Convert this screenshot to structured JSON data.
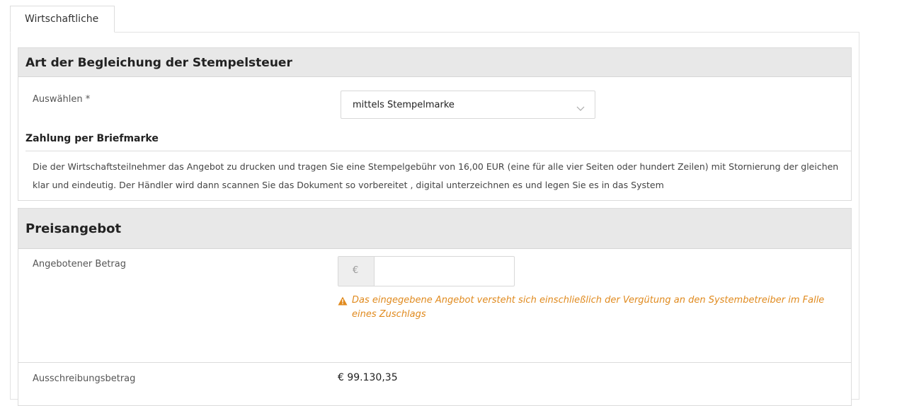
{
  "tab": {
    "label": "Wirtschaftliche"
  },
  "stamp_section": {
    "title": "Art der Begleichung der Stempelsteuer",
    "select_label": "Auswählen *",
    "select_value": "mittels Stempelmarke",
    "subheading": "Zahlung per Briefmarke",
    "description": "Die der Wirtschaftsteilnehmer das Angebot zu drucken und tragen Sie eine Stempelgebühr von 16,00 EUR (eine für alle vier Seiten oder hundert Zeilen) mit Stornierung der gleichen klar und eindeutig. Der Händler wird dann scannen Sie das Dokument so vorbereitet , digital unterzeichnen es und legen Sie es in das System"
  },
  "price_section": {
    "title": "Preisangebot",
    "amount_label": "Angebotener Betrag",
    "currency_symbol": "€",
    "amount_value": "",
    "warning_text": "Das eingegebene Angebot versteht sich einschließlich der Vergütung an den Systembetreiber im Falle eines Zuschlags",
    "warning_color": "#e08a1e",
    "tender_label": "Ausschreibungsbetrag",
    "tender_value": "€ 99.130,35"
  }
}
